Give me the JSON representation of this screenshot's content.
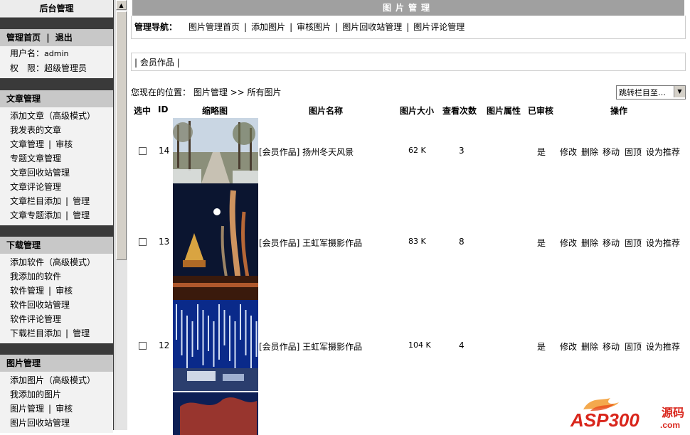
{
  "sidebar": {
    "title": "后台管理",
    "top": {
      "head_home": "管理首页",
      "head_sep": "|",
      "head_logout": "退出",
      "user_label": "用户名：",
      "user_value": "admin",
      "role_label": "权　限：",
      "role_value": "超级管理员"
    },
    "article": {
      "head": "文章管理",
      "items": [
        {
          "a": "添加文章（高级模式）",
          "b": ""
        },
        {
          "a": "我发表的文章",
          "b": ""
        },
        {
          "a": "文章管理",
          "b": "审核"
        },
        {
          "a": "专题文章管理",
          "b": ""
        },
        {
          "a": "文章回收站管理",
          "b": ""
        },
        {
          "a": "文章评论管理",
          "b": ""
        },
        {
          "a": "文章栏目添加",
          "b": "管理"
        },
        {
          "a": "文章专题添加",
          "b": "管理"
        }
      ]
    },
    "download": {
      "head": "下载管理",
      "items": [
        {
          "a": "添加软件（高级模式）",
          "b": ""
        },
        {
          "a": "我添加的软件",
          "b": ""
        },
        {
          "a": "软件管理",
          "b": "审核"
        },
        {
          "a": "软件回收站管理",
          "b": ""
        },
        {
          "a": "软件评论管理",
          "b": ""
        },
        {
          "a": "下载栏目添加",
          "b": "管理"
        }
      ]
    },
    "photo": {
      "head": "图片管理",
      "items": [
        {
          "a": "添加图片（高级模式）",
          "b": ""
        },
        {
          "a": "我添加的图片",
          "b": ""
        },
        {
          "a": "图片管理",
          "b": "审核"
        },
        {
          "a": "图片回收站管理",
          "b": ""
        }
      ]
    }
  },
  "main": {
    "title": "图片管理",
    "nav_label": "管理导航：",
    "nav_links": [
      "图片管理首页",
      "添加图片",
      "审核图片",
      "图片回收站管理",
      "图片评论管理"
    ],
    "category_bar": "| 会员作品 |",
    "crumb": "您现在的位置： 图片管理 >> 所有图片",
    "jump_select": "跳转栏目至…",
    "table": {
      "headers": [
        "选中",
        "ID",
        "缩略图",
        "图片名称",
        "图片大小",
        "查看次数",
        "图片属性",
        "已审核",
        "操作"
      ],
      "rows": [
        {
          "id": "14",
          "name": "[会员作品] 扬州冬天风景",
          "size": "62 K",
          "views": "3",
          "attr": "",
          "approved": "是",
          "actions": [
            "修改",
            "删除",
            "移动",
            "固顶",
            "设为推荐"
          ]
        },
        {
          "id": "13",
          "name": "[会员作品] 王虹军摄影作品",
          "size": "83 K",
          "views": "8",
          "attr": "",
          "approved": "是",
          "actions": [
            "修改",
            "删除",
            "移动",
            "固顶",
            "设为推荐"
          ]
        },
        {
          "id": "12",
          "name": "[会员作品] 王虹军摄影作品",
          "size": "104 K",
          "views": "4",
          "attr": "",
          "approved": "是",
          "actions": [
            "修改",
            "删除",
            "移动",
            "固顶",
            "设为推荐"
          ]
        }
      ]
    }
  },
  "watermark": {
    "brand": "ASP300",
    "suffix": "源码",
    "domain": ".com"
  }
}
